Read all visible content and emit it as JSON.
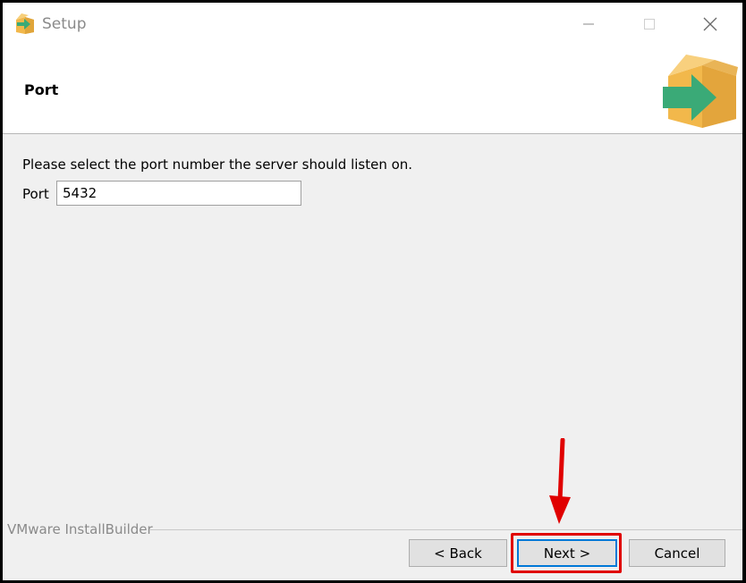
{
  "window": {
    "title": "Setup",
    "app_icon": "installer-box-icon",
    "controls": [
      "minimize-icon",
      "maximize-icon",
      "close-icon"
    ]
  },
  "header": {
    "page_title": "Port",
    "logo_icon": "installer-box-arrow-icon"
  },
  "main": {
    "prompt": "Please select the port number the server should listen on.",
    "port_label": "Port",
    "port_value": "5432"
  },
  "footer": {
    "brand": "VMware InstallBuilder",
    "back_label": "< Back",
    "next_label": "Next >",
    "cancel_label": "Cancel"
  },
  "annotation": {
    "highlight_color": "#e00000",
    "target": "next-button"
  },
  "colors": {
    "accent": "#0078d7",
    "box": "#f2b84b",
    "arrow": "#3aaa77"
  }
}
